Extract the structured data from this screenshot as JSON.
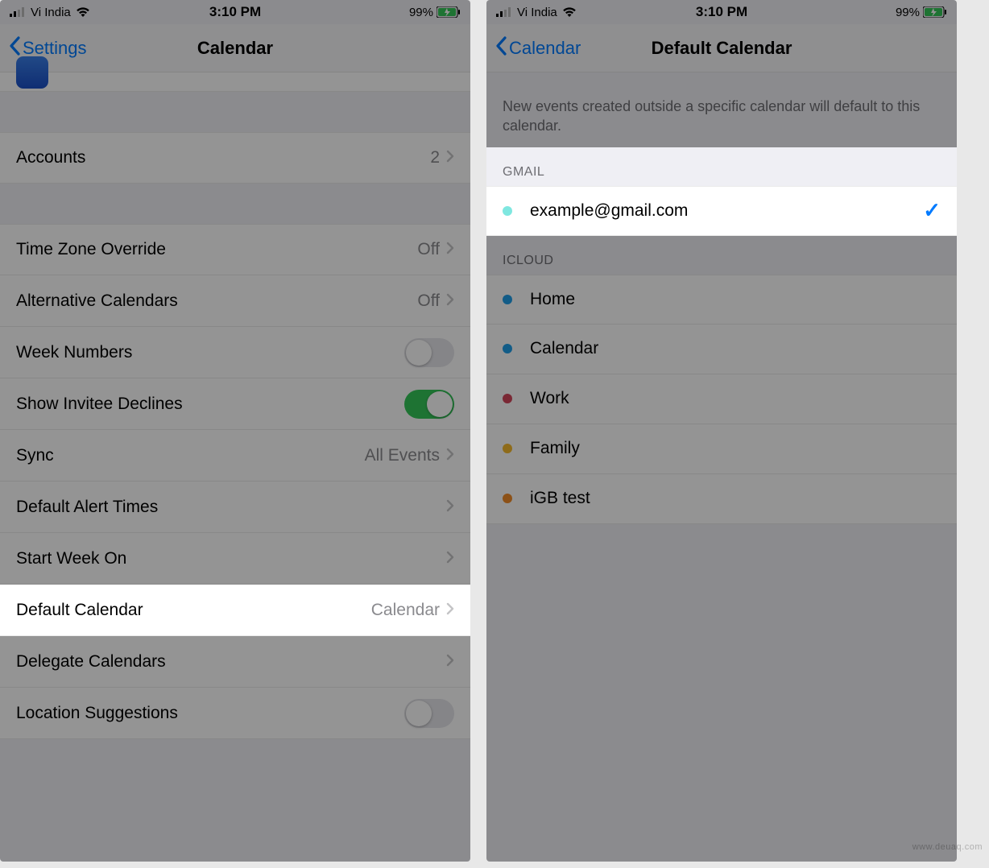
{
  "status": {
    "carrier": "Vi India",
    "time": "3:10 PM",
    "battery_pct": "99%"
  },
  "screen1": {
    "back_label": "Settings",
    "title": "Calendar",
    "rows": {
      "accounts": {
        "label": "Accounts",
        "value": "2"
      },
      "tzo": {
        "label": "Time Zone Override",
        "value": "Off"
      },
      "alt": {
        "label": "Alternative Calendars",
        "value": "Off"
      },
      "week": {
        "label": "Week Numbers"
      },
      "declines": {
        "label": "Show Invitee Declines"
      },
      "sync": {
        "label": "Sync",
        "value": "All Events"
      },
      "alert": {
        "label": "Default Alert Times"
      },
      "start": {
        "label": "Start Week On"
      },
      "default_cal": {
        "label": "Default Calendar",
        "value": "Calendar"
      },
      "delegate": {
        "label": "Delegate Calendars"
      },
      "loc": {
        "label": "Location Suggestions"
      }
    }
  },
  "screen2": {
    "back_label": "Calendar",
    "title": "Default Calendar",
    "description": "New events created outside a specific calendar will default to this calendar.",
    "sections": {
      "gmail": {
        "header": "GMAIL",
        "items": [
          {
            "name": "example@gmail.com",
            "color": "#7fe7e0",
            "selected": true
          }
        ]
      },
      "icloud": {
        "header": "ICLOUD",
        "items": [
          {
            "name": "Home",
            "color": "#1f9fe8"
          },
          {
            "name": "Calendar",
            "color": "#1f9fe8"
          },
          {
            "name": "Work",
            "color": "#d3455b"
          },
          {
            "name": "Family",
            "color": "#f5b92e"
          },
          {
            "name": "iGB test",
            "color": "#f28c28"
          }
        ]
      }
    }
  },
  "watermark": "www.deuaq.com"
}
